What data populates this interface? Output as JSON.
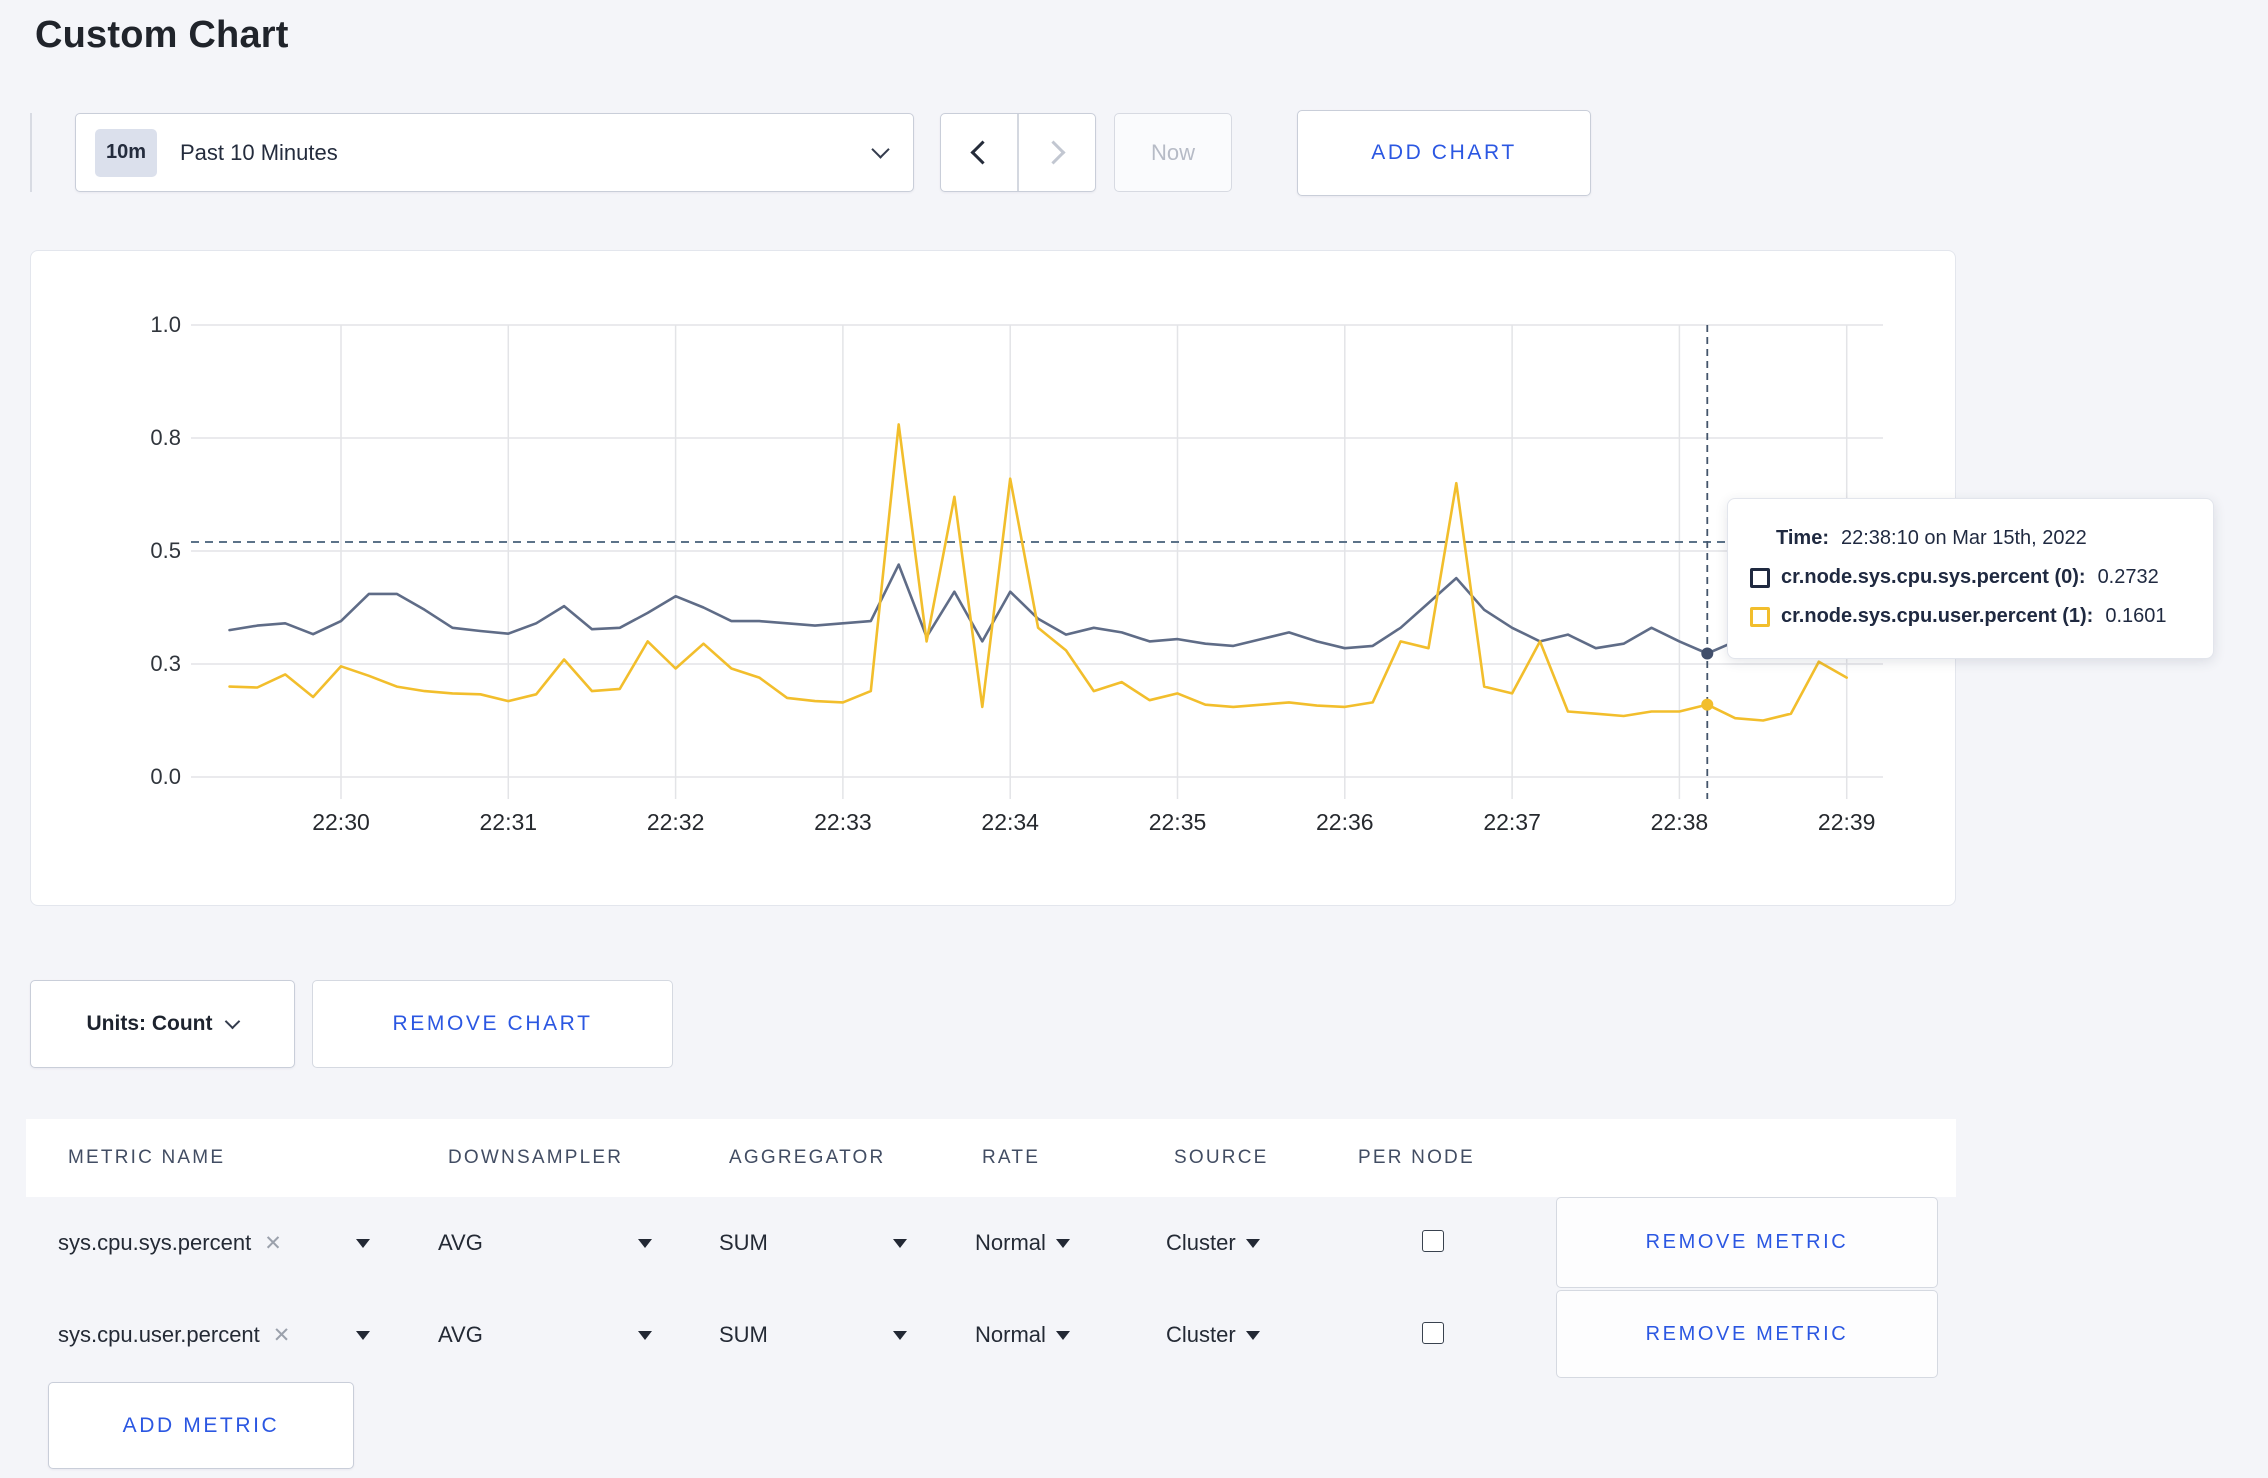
{
  "page": {
    "title": "Custom Chart",
    "background": "#f4f5f9",
    "accent_blue": "#2b57e2"
  },
  "toolbar": {
    "time_badge": "10m",
    "time_label": "Past 10 Minutes",
    "now_label": "Now",
    "add_chart_label": "ADD CHART"
  },
  "chart_data": {
    "type": "line",
    "title": "",
    "xlabel": "",
    "ylabel": "",
    "ylim": [
      0,
      1
    ],
    "grid": true,
    "legend_position": "tooltip-only",
    "y_ticks": [
      {
        "label": "0.0",
        "value": 0
      },
      {
        "label": "0.3",
        "value": 0.25
      },
      {
        "label": "0.5",
        "value": 0.5
      },
      {
        "label": "0.8",
        "value": 0.75
      },
      {
        "label": "1.0",
        "value": 1
      }
    ],
    "x_ticks": [
      "22:30",
      "22:31",
      "22:32",
      "22:33",
      "22:34",
      "22:35",
      "22:36",
      "22:37",
      "22:38",
      "22:39"
    ],
    "x_start_offset_sec": -40,
    "x_interval_sec": 10,
    "threshold_line_value": 0.52,
    "series": [
      {
        "name": "cr.node.sys.cpu.sys.percent",
        "color": "#5f6c87",
        "dot_color": "#414f6b",
        "values": [
          0.325,
          0.335,
          0.34,
          0.316,
          0.345,
          0.405,
          0.405,
          0.37,
          0.33,
          0.323,
          0.317,
          0.34,
          0.378,
          0.327,
          0.33,
          0.363,
          0.4,
          0.375,
          0.345,
          0.345,
          0.34,
          0.335,
          0.34,
          0.345,
          0.47,
          0.31,
          0.41,
          0.3,
          0.41,
          0.35,
          0.315,
          0.33,
          0.32,
          0.3,
          0.305,
          0.295,
          0.29,
          0.305,
          0.32,
          0.3,
          0.285,
          0.29,
          0.33,
          0.385,
          0.44,
          0.37,
          0.33,
          0.3,
          0.315,
          0.285,
          0.295,
          0.33,
          0.3,
          0.2732,
          0.3,
          0.31,
          0.3,
          0.31,
          0.3
        ]
      },
      {
        "name": "cr.node.sys.cpu.user.percent",
        "color": "#f2be2c",
        "dot_color": "#f2be2c",
        "values": [
          0.2,
          0.198,
          0.227,
          0.177,
          0.245,
          0.224,
          0.2,
          0.19,
          0.185,
          0.183,
          0.168,
          0.183,
          0.26,
          0.19,
          0.195,
          0.3,
          0.24,
          0.295,
          0.24,
          0.22,
          0.175,
          0.168,
          0.165,
          0.19,
          0.78,
          0.3,
          0.62,
          0.155,
          0.66,
          0.33,
          0.28,
          0.19,
          0.21,
          0.17,
          0.185,
          0.16,
          0.155,
          0.16,
          0.165,
          0.158,
          0.155,
          0.165,
          0.3,
          0.285,
          0.65,
          0.2,
          0.185,
          0.3,
          0.145,
          0.14,
          0.135,
          0.145,
          0.145,
          0.1601,
          0.13,
          0.125,
          0.14,
          0.255,
          0.22
        ]
      }
    ],
    "crosshair": {
      "time": "22:38:10",
      "index": 53,
      "values": [
        0.2732,
        0.1601
      ]
    }
  },
  "tooltip": {
    "time_label": "Time:",
    "time_value": "22:38:10 on Mar 15th, 2022",
    "rows": [
      {
        "name": "cr.node.sys.cpu.sys.percent (0):",
        "value": "0.2732",
        "swatch_color": "#1f2940"
      },
      {
        "name": "cr.node.sys.cpu.user.percent (1):",
        "value": "0.1601",
        "swatch_color": "#f2be2c"
      }
    ]
  },
  "chart_controls": {
    "units_label": "Units: Count",
    "remove_chart_label": "REMOVE CHART"
  },
  "metrics_table": {
    "headers": [
      "METRIC NAME",
      "DOWNSAMPLER",
      "AGGREGATOR",
      "RATE",
      "SOURCE",
      "PER NODE"
    ],
    "remove_icon": "x",
    "rows": [
      {
        "name": "sys.cpu.sys.percent",
        "downsampler": "AVG",
        "aggregator": "SUM",
        "rate": "Normal",
        "source": "Cluster",
        "per_node_checked": false,
        "remove_label": "REMOVE METRIC"
      },
      {
        "name": "sys.cpu.user.percent",
        "downsampler": "AVG",
        "aggregator": "SUM",
        "rate": "Normal",
        "source": "Cluster",
        "per_node_checked": false,
        "remove_label": "REMOVE METRIC"
      }
    ],
    "add_metric_label": "ADD METRIC"
  }
}
